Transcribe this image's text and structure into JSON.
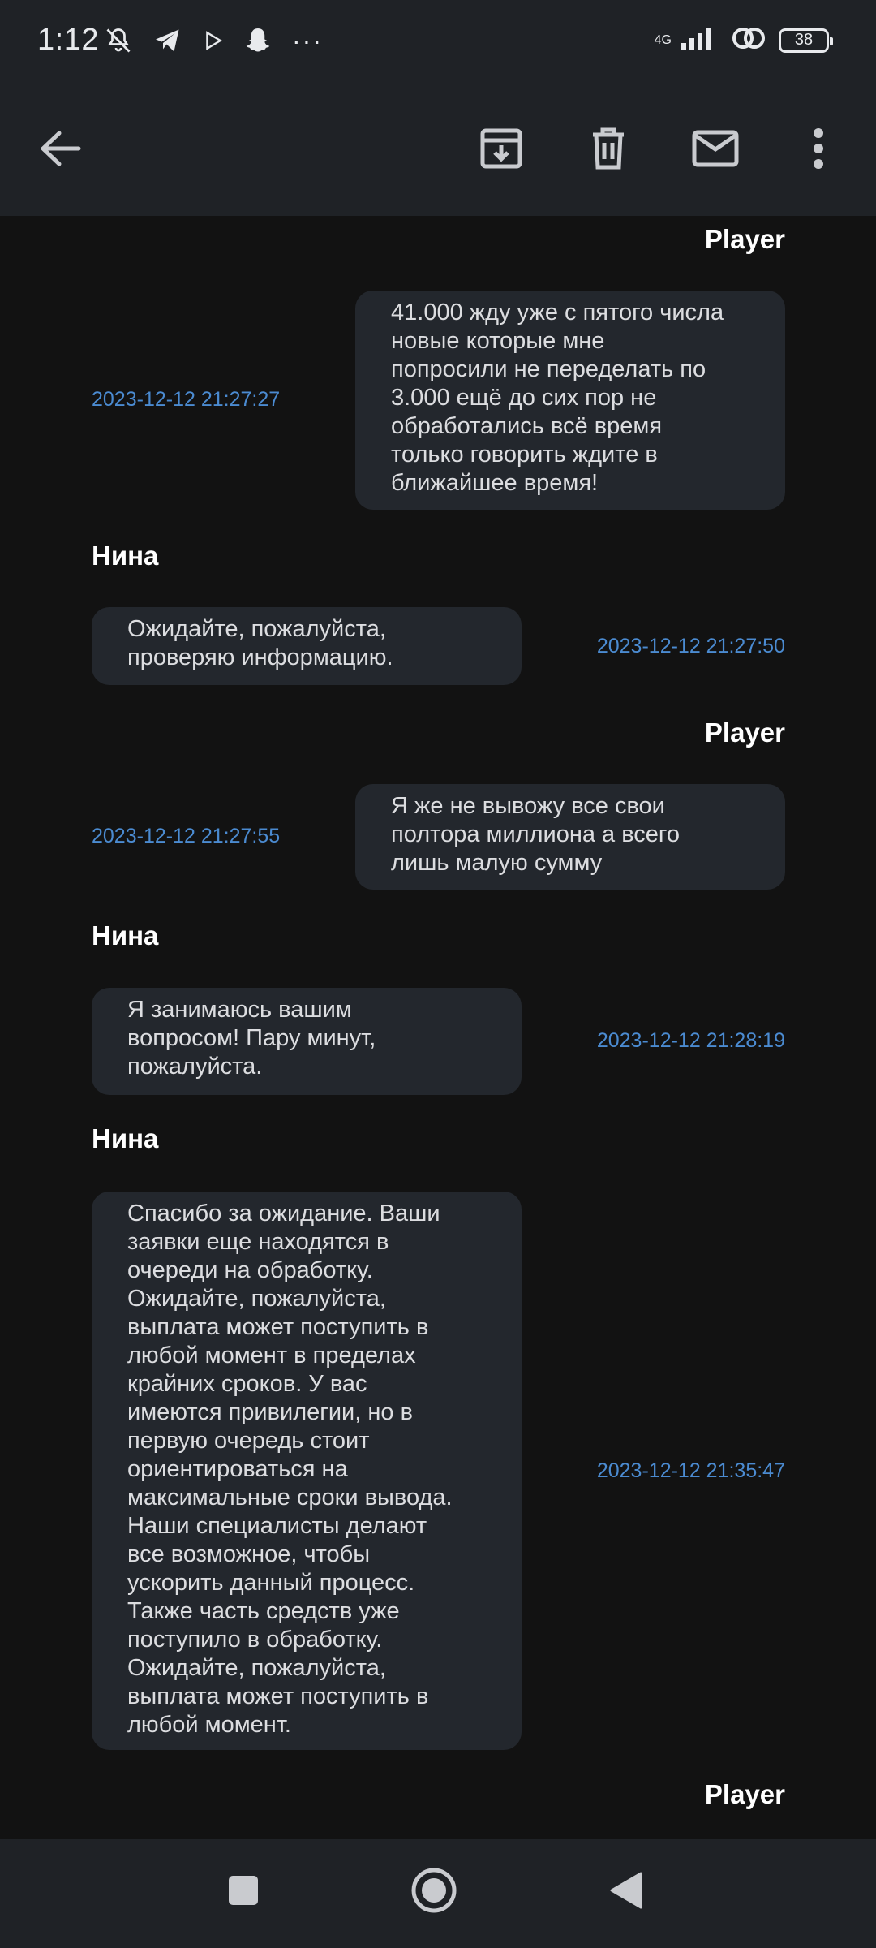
{
  "status_bar": {
    "time": "1:12",
    "network_type": "4G",
    "battery_level": "38",
    "more": "···",
    "icons": [
      "bell-off-icon",
      "telegram-icon",
      "play-store-icon",
      "snapchat-icon",
      "signal-icon",
      "link-icon",
      "battery-icon"
    ]
  },
  "toolbar": {
    "icons": [
      "back-arrow-icon",
      "archive-icon",
      "delete-icon",
      "mail-icon",
      "more-vert-icon"
    ]
  },
  "messages": [
    {
      "sender": "Player",
      "side": "right",
      "text": "41.000 жду уже с пятого числа\nновые которые мне\nпопросили не переделать по\n3.000 ещё до сих пор не\nобработались всё время\nтолько говорить ждите в\nближайшее время!",
      "timestamp": "2023-12-12 21:27:27"
    },
    {
      "sender": "Нина",
      "side": "left",
      "text": "Ожидайте, пожалуйста,\nпроверяю информацию.",
      "timestamp": "2023-12-12 21:27:50"
    },
    {
      "sender": "Player",
      "side": "right",
      "text": "Я же не вывожу все свои\nполтора миллиона а всего\nлишь малую сумму",
      "timestamp": "2023-12-12 21:27:55"
    },
    {
      "sender": "Нина",
      "side": "left",
      "text": "Я занимаюсь вашим\nвопросом! Пару минут,\nпожалуйста.",
      "timestamp": "2023-12-12 21:28:19"
    },
    {
      "sender": "Нина",
      "side": "left",
      "text": "Спасибо за ожидание. Ваши\nзаявки  еще находятся в\nочереди на обработку.\nОжидайте, пожалуйста,\nвыплата может поступить в\nлюбой момент в пределах\nкрайних сроков. У вас\nимеются привилегии, но в\nпервую очередь стоит\nориентироваться на\nмаксимальные сроки вывода.\nНаши специалисты делают\nвсе возможное, чтобы\nускорить данный процесс.\nТакже часть средств уже\nпоступило в обработку.\nОжидайте, пожалуйста,\nвыплата может поступить в\nлюбой момент.",
      "timestamp": "2023-12-12 21:35:47"
    }
  ],
  "trailing_sender": "Player",
  "nav_bar": {
    "icons": [
      "recents-icon",
      "home-icon",
      "back-icon"
    ]
  },
  "colors": {
    "background": "#121212",
    "bar": "#1f2226",
    "bubble": "#23272d",
    "timestamp": "#4b8bd1"
  }
}
